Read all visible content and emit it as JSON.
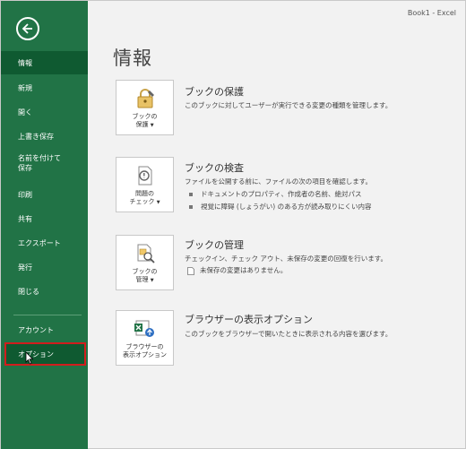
{
  "window": {
    "title": "Book1 - Excel"
  },
  "sidebar": {
    "items": [
      {
        "label": "情報"
      },
      {
        "label": "新規"
      },
      {
        "label": "開く"
      },
      {
        "label": "上書き保存"
      },
      {
        "label_line1": "名前を付けて",
        "label_line2": "保存"
      },
      {
        "label": "印刷"
      },
      {
        "label": "共有"
      },
      {
        "label": "エクスポート"
      },
      {
        "label": "発行"
      },
      {
        "label": "閉じる"
      },
      {
        "label": "アカウント"
      },
      {
        "label": "オプション"
      }
    ]
  },
  "main": {
    "page_title": "情報",
    "sections": [
      {
        "tile_line1": "ブックの",
        "tile_line2": "保護",
        "title": "ブックの保護",
        "desc": "このブックに対してユーザーが実行できる変更の種類を管理します。"
      },
      {
        "tile_line1": "問題の",
        "tile_line2": "チェック",
        "title": "ブックの検査",
        "desc": "ファイルを公開する前に、ファイルの次の項目を確認します。",
        "bullets": [
          "ドキュメントのプロパティ、作成者の名前、絶対パス",
          "視覚に障碍 (しょうがい) のある方が読み取りにくい内容"
        ]
      },
      {
        "tile_line1": "ブックの",
        "tile_line2": "管理",
        "title": "ブックの管理",
        "desc": "チェックイン、チェック アウト、未保存の変更の回復を行います。",
        "note": "未保存の変更はありません。"
      },
      {
        "tile_line1": "ブラウザーの",
        "tile_line2": "表示オプション",
        "title": "ブラウザーの表示オプション",
        "desc": "このブックをブラウザーで開いたときに表示される内容を選びます。"
      }
    ]
  },
  "colors": {
    "sidebar": "#217346",
    "sidebar_active": "#0f5a31",
    "highlight": "#d21d1d"
  }
}
